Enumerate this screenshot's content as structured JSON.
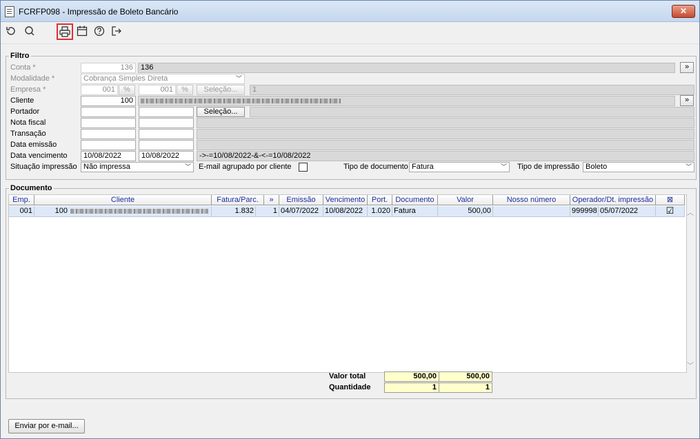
{
  "window": {
    "title": "FCRFP098 - Impressão de Boleto Bancário",
    "close_glyph": "✕"
  },
  "toolbar": {
    "icons": [
      "undo-icon",
      "search-icon",
      "print-icon",
      "calendar-icon",
      "help-icon",
      "exit-icon"
    ]
  },
  "filtro": {
    "legend": "Filtro",
    "conta_label": "Conta *",
    "conta_value": "136",
    "conta_desc": "136",
    "modalidade_label": "Modalidade *",
    "modalidade_value": "Cobrança Simples Direta",
    "empresa_label": "Empresa *",
    "empresa_from": "001",
    "empresa_to": "001",
    "empresa_selecao": "Seleção...",
    "empresa_desc": "1",
    "cliente_label": "Cliente",
    "cliente_value": "100",
    "portador_label": "Portador",
    "portador_selecao": "Seleção...",
    "nota_fiscal_label": "Nota fiscal",
    "transacao_label": "Transação",
    "data_emissao_label": "Data emissão",
    "data_vencimento_label": "Data vencimento",
    "data_venc_from": "10/08/2022",
    "data_venc_to": "10/08/2022",
    "data_venc_expr": "->-=10/08/2022-&-<-=10/08/2022",
    "situacao_label": "Situação impressão",
    "situacao_value": "Não impressa",
    "email_agrupado_label": "E-mail agrupado por cliente",
    "tipo_documento_label": "Tipo de documento",
    "tipo_documento_value": "Fatura",
    "tipo_impressao_label": "Tipo de impressão",
    "tipo_impressao_value": "Boleto",
    "expand_glyph": "»"
  },
  "documento": {
    "legend": "Documento",
    "columns": [
      "Emp.",
      "Cliente",
      "Fatura/Parc.",
      "»",
      "Emissão",
      "Vencimento",
      "Port.",
      "Documento",
      "Valor",
      "Nosso número",
      "Operador/Dt. impressão",
      "⊠"
    ],
    "rows": [
      {
        "emp": "001",
        "cliente": "100",
        "fatura": "1.832",
        "parc": "1",
        "emissao": "04/07/2022",
        "vencimento": "10/08/2022",
        "port": "1.020",
        "documento": "Fatura",
        "valor": "500,00",
        "nosso_numero": "",
        "operador": "999998",
        "dt_impressao": "05/07/2022",
        "checked": "☑"
      }
    ],
    "valor_total_label": "Valor total",
    "valor_total_1": "500,00",
    "valor_total_2": "500,00",
    "quantidade_label": "Quantidade",
    "quantidade_1": "1",
    "quantidade_2": "1"
  },
  "footer": {
    "email_button": "Enviar por e-mail..."
  },
  "colors": {
    "header_text": "#1a2b9c",
    "selected_row": "#dde9f8",
    "totals_bg": "#ffffcc",
    "highlight_border": "#e03030"
  }
}
